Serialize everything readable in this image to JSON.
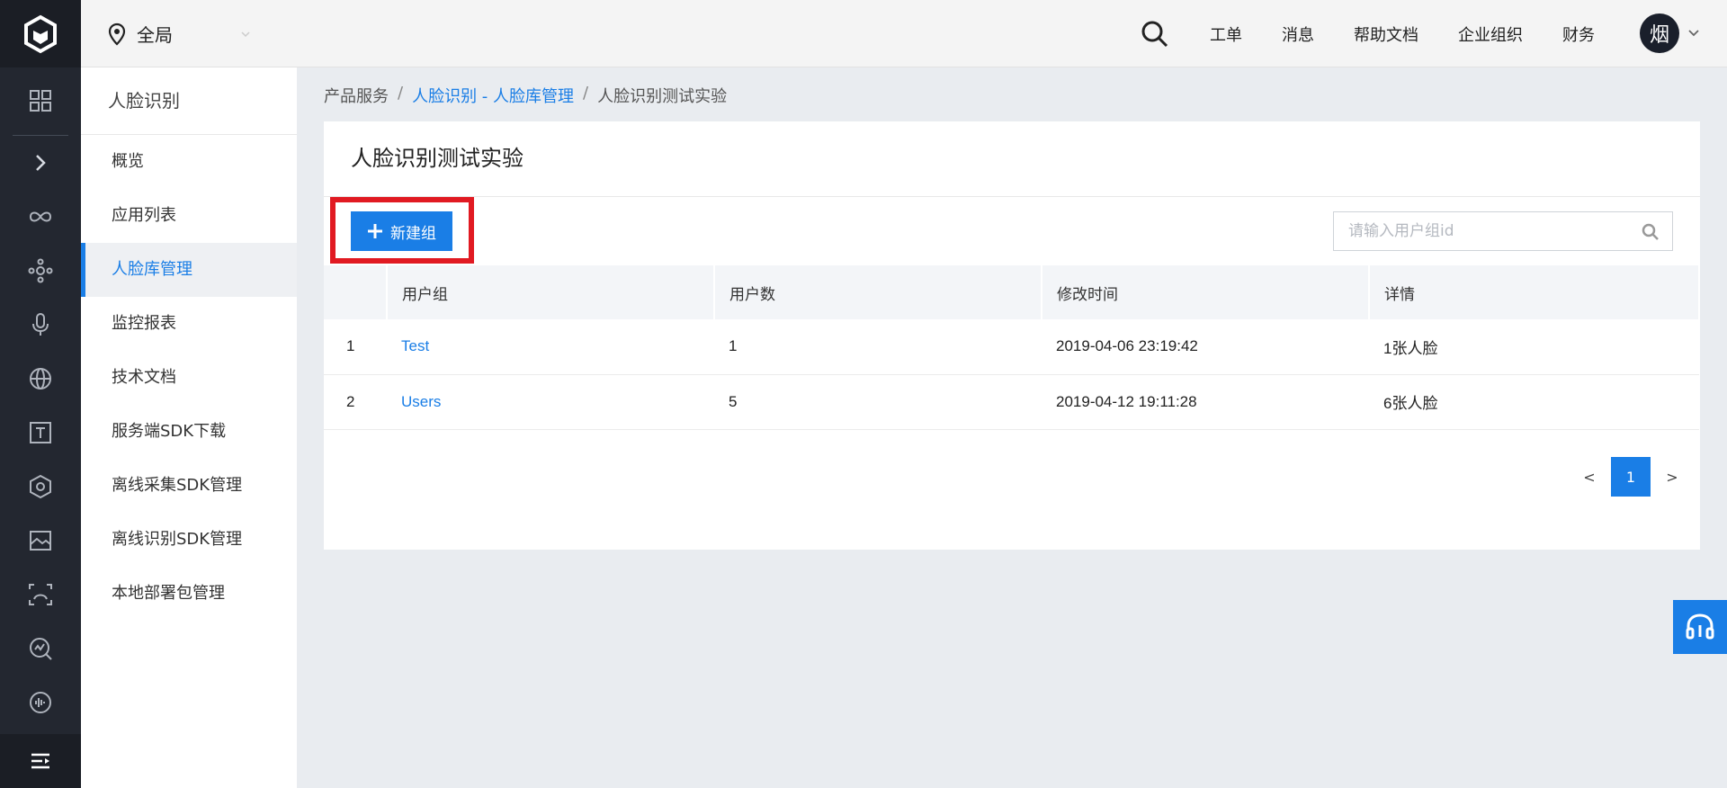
{
  "topbar": {
    "region_label": "全局",
    "links": [
      "工单",
      "消息",
      "帮助文档",
      "企业组织",
      "财务"
    ],
    "avatar_text": "烟"
  },
  "subnav": {
    "title": "人脸识别",
    "items": [
      {
        "label": "概览"
      },
      {
        "label": "应用列表"
      },
      {
        "label": "人脸库管理"
      },
      {
        "label": "监控报表"
      },
      {
        "label": "技术文档"
      },
      {
        "label": "服务端SDK下载"
      },
      {
        "label": "离线采集SDK管理"
      },
      {
        "label": "离线识别SDK管理"
      },
      {
        "label": "本地部署包管理"
      }
    ],
    "active_index": 2
  },
  "breadcrumb": {
    "root": "产品服务",
    "sep": "/",
    "parent": "人脸识别 - 人脸库管理",
    "current": "人脸识别测试实验"
  },
  "card": {
    "title": "人脸识别测试实验",
    "new_button_label": "新建组",
    "search_placeholder": "请输入用户组id"
  },
  "table": {
    "headers": [
      "",
      "用户组",
      "用户数",
      "修改时间",
      "详情"
    ],
    "rows": [
      {
        "index": "1",
        "group": "Test",
        "users": "1",
        "modified": "2019-04-06 23:19:42",
        "detail": "1张人脸"
      },
      {
        "index": "2",
        "group": "Users",
        "users": "5",
        "modified": "2019-04-12 19:11:28",
        "detail": "6张人脸"
      }
    ]
  },
  "pager": {
    "prev": "<",
    "current": "1",
    "next": ">"
  },
  "colors": {
    "accent": "#1a7ee6",
    "highlight": "#e11a22",
    "iconbar": "#232730"
  },
  "icons": {
    "iconbar": [
      "dashboard-icon",
      "expand-icon",
      "infinity-icon",
      "network-icon",
      "microphone-icon",
      "globe-icon",
      "text-icon",
      "hexagon-icon",
      "image-icon",
      "face-scan-icon",
      "analytics-icon",
      "audio-icon",
      "menu-icon"
    ]
  }
}
